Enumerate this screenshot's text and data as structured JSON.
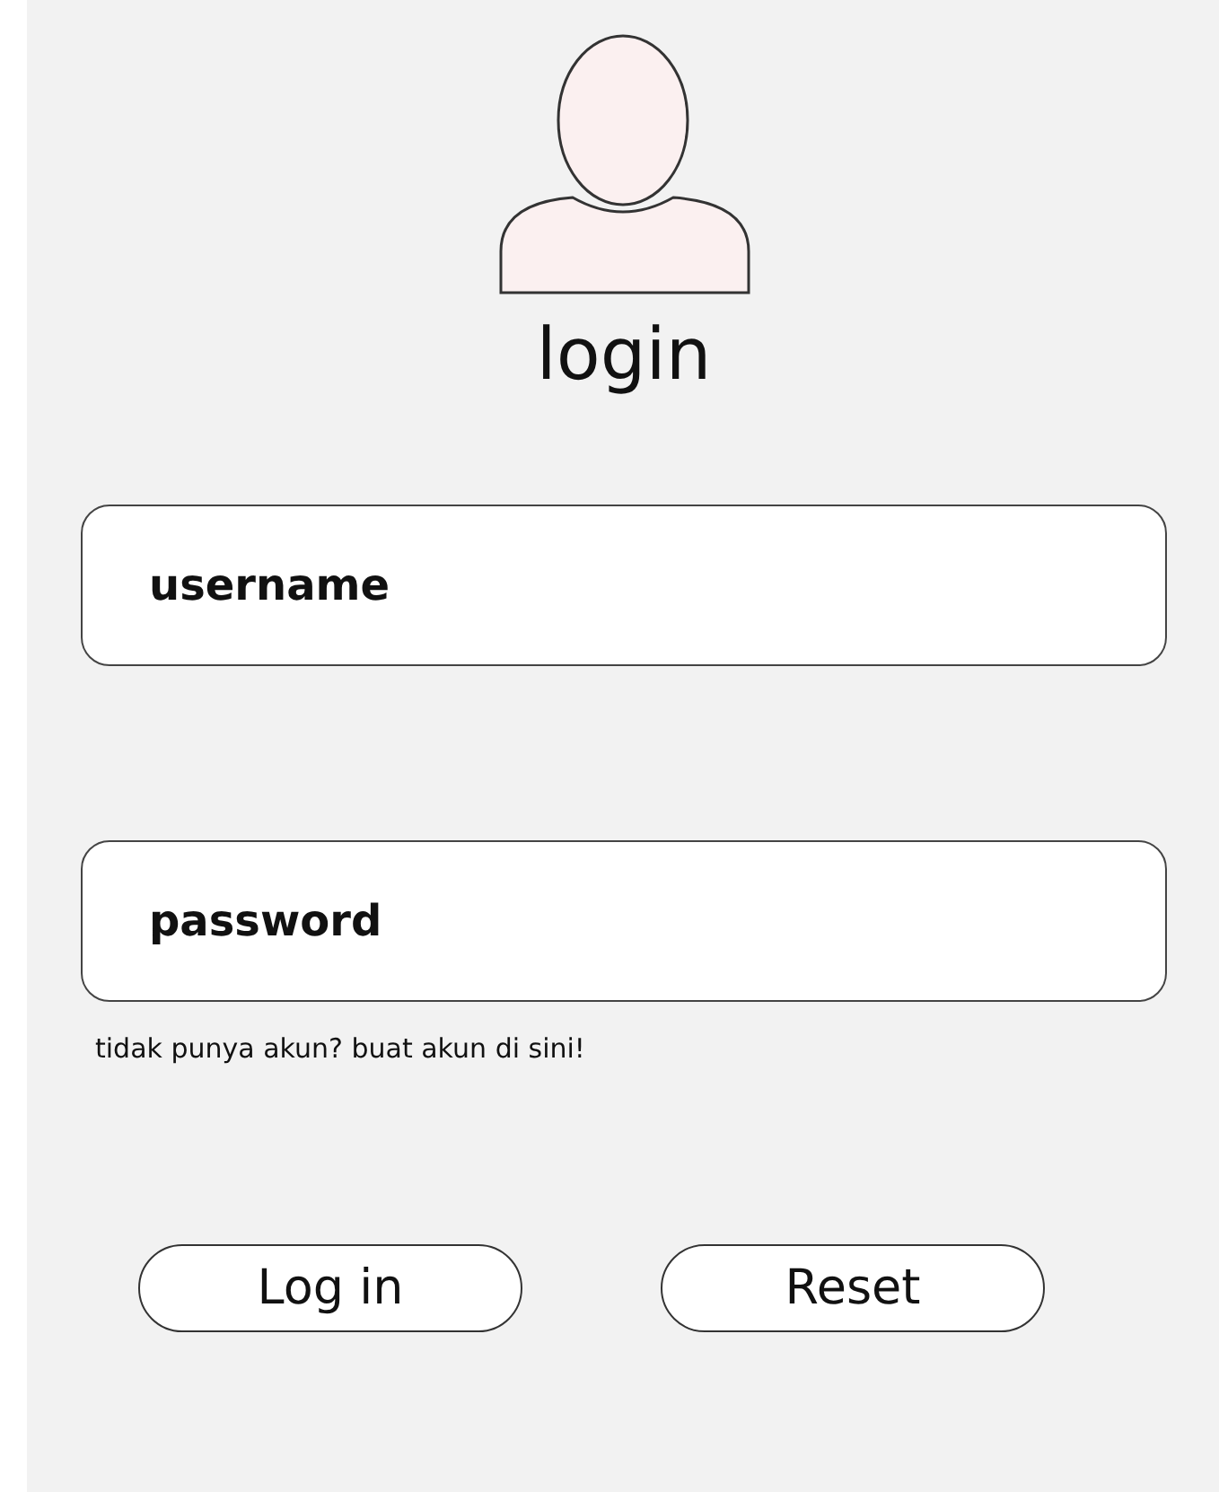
{
  "title": "login",
  "fields": [
    {
      "placeholder": "username"
    },
    {
      "placeholder": "password"
    }
  ],
  "signup_link": "tidak punya akun? buat akun di sini!",
  "buttons": [
    "Log in",
    "Reset"
  ]
}
